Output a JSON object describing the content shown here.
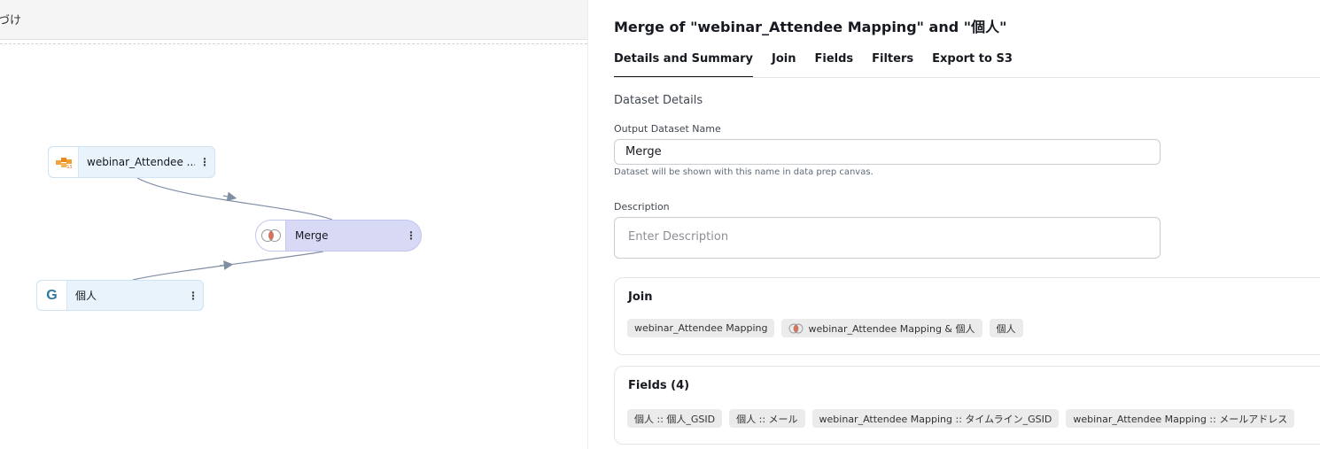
{
  "canvas": {
    "title": "づけ",
    "nodes": {
      "attendee": {
        "label": "webinar_Attendee ...",
        "menu": "⋮",
        "icon": "s3-bucket-icon"
      },
      "merge": {
        "label": "Merge",
        "menu": "⋮",
        "icon": "venn-join-icon"
      },
      "personal": {
        "label": "個人",
        "menu": "⋮",
        "icon": "google-g-icon",
        "icon_glyph": "G"
      }
    }
  },
  "panel": {
    "title": "Merge of \"webinar_Attendee Mapping\" and \"個人\"",
    "tabs": [
      {
        "label": "Details and Summary",
        "active": true
      },
      {
        "label": "Join",
        "active": false
      },
      {
        "label": "Fields",
        "active": false
      },
      {
        "label": "Filters",
        "active": false
      },
      {
        "label": "Export to S3",
        "active": false
      }
    ],
    "section_label": "Dataset Details",
    "output_name": {
      "label": "Output Dataset Name",
      "value": "Merge",
      "help": "Dataset will be shown with this name in data prep canvas."
    },
    "description": {
      "label": "Description",
      "placeholder": "Enter Description"
    },
    "join": {
      "title": "Join",
      "chips": [
        "webinar_Attendee Mapping",
        "webinar_Attendee Mapping & 個人",
        "個人"
      ]
    },
    "fields": {
      "title": "Fields (4)",
      "chips": [
        "個人 :: 個人_GSID",
        "個人 :: メール",
        "webinar_Attendee Mapping :: タイムライン_GSID",
        "webinar_Attendee Mapping :: メールアドレス"
      ]
    }
  },
  "colors": {
    "node_fill": "#e8f3fb",
    "merge_fill": "#d7d9f5",
    "edge": "#7f8ea3",
    "chip_fill": "#ebebeb"
  }
}
